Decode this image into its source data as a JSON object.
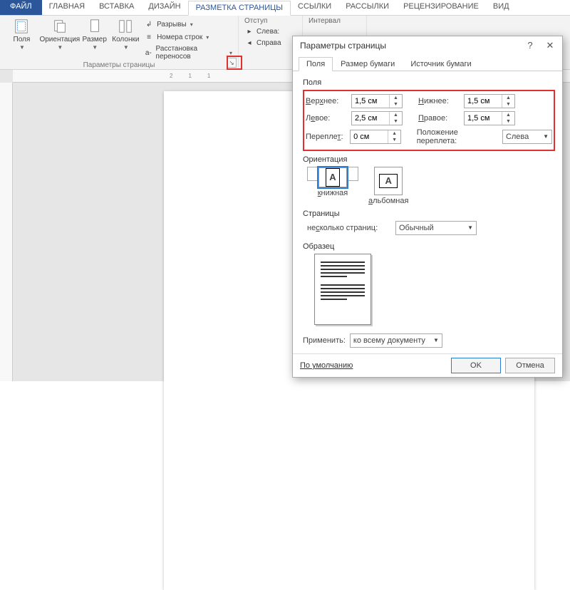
{
  "tabs": {
    "file": "ФАЙЛ",
    "home": "ГЛАВНАЯ",
    "insert": "ВСТАВКА",
    "design": "ДИЗАЙН",
    "layout": "РАЗМЕТКА СТРАНИЦЫ",
    "references": "ССЫЛКИ",
    "mailings": "РАССЫЛКИ",
    "review": "РЕЦЕНЗИРОВАНИЕ",
    "view": "ВИД"
  },
  "ribbon": {
    "margins": "Поля",
    "orientation": "Ориентация",
    "size": "Размер",
    "columns": "Колонки",
    "breaks": "Разрывы",
    "line_numbers": "Номера строк",
    "hyphenation": "Расстановка переносов",
    "group_page_setup": "Параметры страницы",
    "indent_hdr": "Отступ",
    "spacing_hdr": "Интервал",
    "indent_left": "Слева:",
    "indent_right": "Справа"
  },
  "ruler_marks": [
    "2",
    "1",
    "",
    "1"
  ],
  "dialog": {
    "title": "Параметры страницы",
    "tabs": {
      "fields": "Поля",
      "paper": "Размер бумаги",
      "source": "Источник бумаги"
    },
    "sect_fields": "Поля",
    "top_lbl": "Верхнее:",
    "top_val": "1,5 см",
    "bottom_lbl": "Нижнее:",
    "bottom_val": "1,5 см",
    "left_lbl": "Левое:",
    "left_val": "2,5 см",
    "right_lbl": "Правое:",
    "right_val": "1,5 см",
    "gutter_lbl": "Переплет:",
    "gutter_val": "0 см",
    "gutter_pos_lbl": "Положение переплета:",
    "gutter_pos_val": "Слева",
    "sect_orient": "Ориентация",
    "portrait": "книжная",
    "landscape": "альбомная",
    "sect_pages": "Страницы",
    "multi_lbl": "несколько страниц:",
    "multi_val": "Обычный",
    "sect_preview": "Образец",
    "apply_lbl": "Применить:",
    "apply_val": "ко всему документу",
    "default_btn": "По умолчанию",
    "ok": "OK",
    "cancel": "Отмена"
  }
}
